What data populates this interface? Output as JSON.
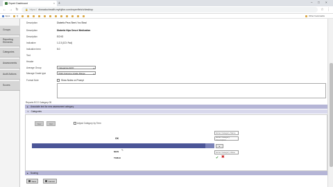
{
  "browser": {
    "tab_title": "Expert Dashboard",
    "tab_close": "×",
    "new_tab": "+",
    "url_scheme": "https://",
    "url_rest": "dionadochealth.myfujitor.com/expertfetch/desktop",
    "window_min": "–",
    "window_max": "□",
    "window_close": "×",
    "bookmarks": [
      "Apps",
      "Q",
      "",
      "",
      "",
      "",
      "",
      "",
      "",
      "",
      "",
      "",
      "",
      "",
      "",
      "",
      "",
      "",
      "",
      ""
    ],
    "other_bookmarks": "Other bookmarks"
  },
  "sidebar": {
    "items": [
      "Groups",
      "Reporting Elements",
      "Categories",
      "Assessments",
      "Audit Actions",
      "Scores"
    ]
  },
  "form": {
    "rows": [
      {
        "label": "Description",
        "value": "Diabetic Pecs Steel / Inc Steal"
      },
      {
        "label": "Description",
        "value": "Diabetic Hips Descr/ Medication"
      },
      {
        "label": "Description",
        "value": "ECHO"
      },
      {
        "label": "Indicative",
        "value": "1.2.3 (CO: Fsd)"
      },
      {
        "label": "Indicative term",
        "value": "5.0"
      },
      {
        "label": "Text",
        "value": ""
      },
      {
        "label": "Header",
        "value": ""
      }
    ],
    "average_group_label": "Average Group",
    "average_group_value": "Categories ECO",
    "manage_grade_label": "Manage Grade type",
    "manage_grade_value": "Multi Outcome Grade Range",
    "format_label": "Format Note",
    "format_checkbox_label": "Show Notes on Prompt"
  },
  "sections": {
    "reports_label": "Reports ECO Category 05",
    "first_bar": "Associate text for new assessment category",
    "categories_bar": "Categories",
    "last_bar": "Scoring"
  },
  "categories": {
    "new_button": "New",
    "delete_button": "Del",
    "alpha_checkbox_label": "Adjust Category by Term",
    "name_placeholder": "Enter Category Name",
    "desc_placeholder": "Enter Category Description",
    "value_placeholder": "Enter Category Value",
    "ok_label": "OK",
    "row_1": "NEW",
    "row_2": "TABLE",
    "move_button": "▸"
  },
  "footer": {
    "save_label": "Save",
    "cancel_label": "Cancel"
  },
  "colors": {
    "section_bar": "#b5b5d6",
    "category_row": "#4b5597",
    "accept": "#2e8b2e",
    "reject": "#cc2222"
  }
}
